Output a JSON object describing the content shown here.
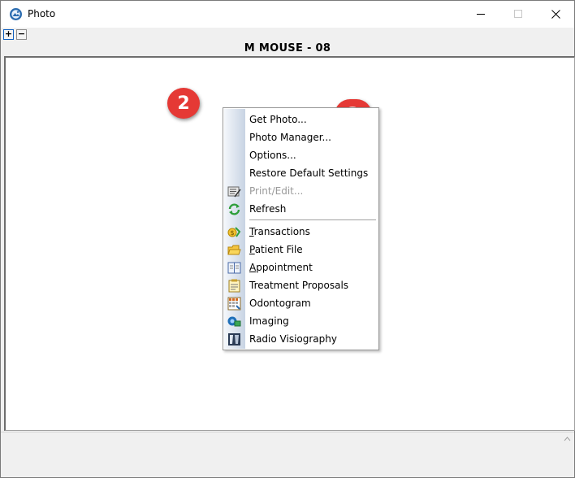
{
  "window": {
    "title": "Photo",
    "app_icon": "photo-app-icon",
    "controls": [
      "minimize-icon",
      "maximize-icon",
      "close-icon"
    ]
  },
  "toolbar": {
    "expand_label": "+",
    "collapse_label": "−"
  },
  "patient": {
    "name": "M MOUSE - 08"
  },
  "callouts": {
    "step2": "2",
    "step3": "3",
    "color": "#e53935"
  },
  "menu": {
    "items": [
      {
        "first": "",
        "rest": "Get Photo...",
        "enabled": true,
        "icon": null
      },
      {
        "first": "",
        "rest": "Photo Manager...",
        "enabled": true,
        "icon": null
      },
      {
        "first": "",
        "rest": "Options...",
        "enabled": true,
        "icon": null
      },
      {
        "first": "",
        "rest": "Restore Default Settings",
        "enabled": true,
        "icon": null
      },
      {
        "first": "",
        "rest": "Print/Edit...",
        "enabled": false,
        "icon": "print-edit-icon"
      },
      {
        "first": "",
        "rest": "Refresh",
        "enabled": true,
        "icon": "refresh-icon"
      },
      {
        "first": "T",
        "rest": "ransactions",
        "enabled": true,
        "icon": "transactions-icon"
      },
      {
        "first": "P",
        "rest": "atient File",
        "enabled": true,
        "icon": "patient-file-icon"
      },
      {
        "first": "A",
        "rest": "ppointment",
        "enabled": true,
        "icon": "appointment-icon"
      },
      {
        "first": "",
        "rest": "Treatment Proposals",
        "enabled": true,
        "icon": "treatment-proposals-icon"
      },
      {
        "first": "",
        "rest": "Odontogram",
        "enabled": true,
        "icon": "odontogram-icon"
      },
      {
        "first": "",
        "rest": "Imaging",
        "enabled": true,
        "icon": "imaging-icon"
      },
      {
        "first": "",
        "rest": "Radio Visiography",
        "enabled": true,
        "icon": "radio-visiography-icon"
      }
    ]
  }
}
